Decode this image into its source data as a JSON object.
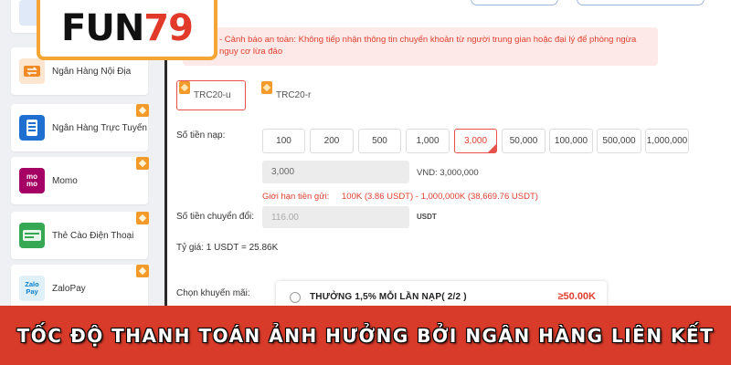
{
  "logo": {
    "word": "FUN",
    "digits": "79"
  },
  "sidebar": {
    "items": [
      {
        "label": "Ngân Hàng Nội Địa",
        "icon": "bank-transfer-icon"
      },
      {
        "label": "Ngân Hàng Trực Tuyến",
        "icon": "mobile-banking-icon"
      },
      {
        "label": "Momo",
        "icon": "momo-icon",
        "icon_text": "mo mo"
      },
      {
        "label": "Thẻ Cào Điện Thoại",
        "icon": "phone-card-icon"
      },
      {
        "label": "ZaloPay",
        "icon": "zalopay-icon",
        "icon_text": "Zalo Pay"
      }
    ]
  },
  "warning": {
    "text": "- Cảnh báo an toàn: Không tiếp nhận thông tin chuyển khoản từ người trung gian hoặc đại lý để phòng ngừa nguy cơ lừa đảo"
  },
  "networks": [
    {
      "label": "TRC20-u",
      "active": true
    },
    {
      "label": "TRC20-r",
      "active": false
    }
  ],
  "deposit": {
    "amount_label": "Số tiền nạp:",
    "amounts": [
      "100",
      "200",
      "500",
      "1,000",
      "3,000",
      "50,000",
      "100,000",
      "500,000",
      "1,000,000"
    ],
    "selected": "3,000",
    "amount_value": "3,000",
    "vnd_text": "VND: 3,000,000",
    "limit_label": "Giới hạn tiền gửi:",
    "limit_value": "100K (3.86 USDT) - 1,000,000K (38,669.76 USDT)",
    "convert_label": "Số tiền chuyển đổi:",
    "convert_value": "116.00",
    "convert_unit": "USDT",
    "rate_text": "Tỷ giá:  1   USDT  = 25.86K",
    "promo_label": "Chọn khuyến mãi:",
    "promo_text": "THƯỞNG 1,5% MỖI LẦN NẠP( 2/2 )",
    "promo_min": "≥50.00K"
  },
  "banner": {
    "text": "TỐC ĐỘ THANH TOÁN ẢNH HƯỞNG BỞI NGÂN HÀNG LIÊN KẾT"
  },
  "colors": {
    "accent_red": "#e8514b",
    "badge_orange": "#f39a2b",
    "banner_red": "#d93b2a"
  }
}
